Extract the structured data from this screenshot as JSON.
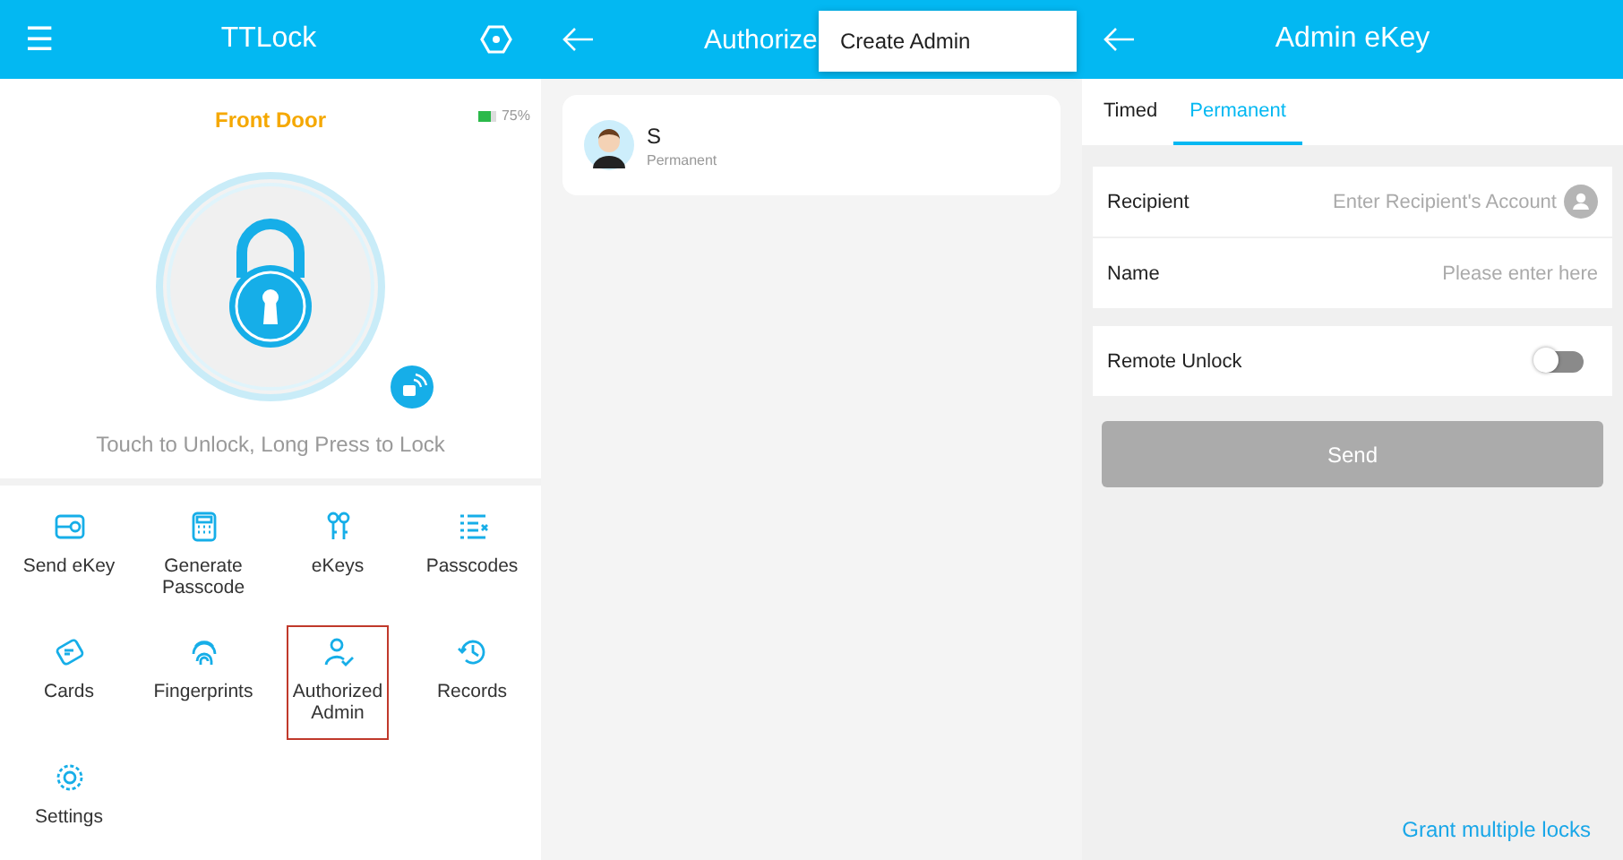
{
  "home": {
    "title": "TTLock",
    "menu_icon": "☰",
    "lock_name": "Front Door",
    "battery": {
      "level": 0.75,
      "reading": "75%"
    },
    "hint": "Touch to Unlock, Long Press to Lock",
    "features": [
      {
        "label": "Send eKey",
        "selected": false
      },
      {
        "label": "Generate Passcode",
        "selected": false
      },
      {
        "label": "eKeys",
        "selected": false
      },
      {
        "label": "Passcodes",
        "selected": false
      },
      {
        "label": "Cards",
        "selected": false
      },
      {
        "label": "Fingerprints",
        "selected": false
      },
      {
        "label": "Authorized Admin",
        "selected": true
      },
      {
        "label": "Records",
        "selected": false
      },
      {
        "label": "Settings",
        "selected": false
      }
    ]
  },
  "admins": {
    "title": "Authorize",
    "menu": [
      "Create Admin"
    ],
    "list": [
      {
        "name": "S",
        "type": "Permanent"
      }
    ]
  },
  "admin_ekey": {
    "title": "Admin eKey",
    "tabs": [
      {
        "label": "Timed",
        "selected": false
      },
      {
        "label": "Permanent",
        "selected": true
      }
    ],
    "fields": [
      {
        "label": "Recipient",
        "placeholder": "Enter Recipient's Account"
      },
      {
        "label": "Name",
        "placeholder": "Please enter here"
      }
    ],
    "remote_unlock": {
      "label": "Remote Unlock",
      "on": false
    },
    "send": {
      "label": "Send",
      "disabled": true
    },
    "link": "Grant multiple locks"
  }
}
